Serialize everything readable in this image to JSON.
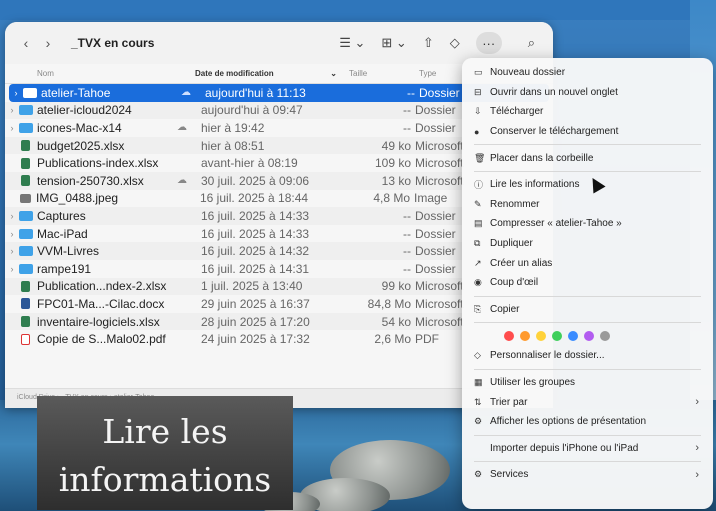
{
  "finder": {
    "title": "_TVX en cours",
    "columns": {
      "name": "Nom",
      "date": "Date de modification",
      "size": "Taille",
      "type": "Type"
    },
    "rows": [
      {
        "name": "atelier-Tahoe",
        "date": "aujourd'hui à 11:13",
        "size": "--",
        "type": "Dossier",
        "icon": "folder-icon",
        "selected": true,
        "cloud": "cloud-icon",
        "expand": "›"
      },
      {
        "name": "atelier-icloud2024",
        "date": "aujourd'hui à 09:47",
        "size": "--",
        "type": "Dossier",
        "icon": "folder-icon",
        "cloud": "",
        "expand": "›"
      },
      {
        "name": "icones-Mac-x14",
        "date": "hier à 19:42",
        "size": "--",
        "type": "Dossier",
        "icon": "folder-icon",
        "cloud": "cloud-icon",
        "expand": "›"
      },
      {
        "name": "budget2025.xlsx",
        "date": "hier à 08:51",
        "size": "49 ko",
        "type": "Microsoft",
        "icon": "excel-icon",
        "cloud": "",
        "expand": ""
      },
      {
        "name": "Publications-index.xlsx",
        "date": "avant-hier à 08:19",
        "size": "109 ko",
        "type": "Microsoft",
        "icon": "excel-icon",
        "cloud": "",
        "expand": ""
      },
      {
        "name": "tension-250730.xlsx",
        "date": "30 juil. 2025 à 09:06",
        "size": "13 ko",
        "type": "Microsoft",
        "icon": "excel-icon",
        "cloud": "cloud-icon",
        "expand": ""
      },
      {
        "name": "IMG_0488.jpeg",
        "date": "16 juil. 2025 à 18:44",
        "size": "4,8 Mo",
        "type": "Image",
        "icon": "image-icon",
        "cloud": "",
        "expand": ""
      },
      {
        "name": "Captures",
        "date": "16 juil. 2025 à 14:33",
        "size": "--",
        "type": "Dossier",
        "icon": "folder-icon",
        "cloud": "",
        "expand": "›"
      },
      {
        "name": "Mac-iPad",
        "date": "16 juil. 2025 à 14:33",
        "size": "--",
        "type": "Dossier",
        "icon": "folder-icon",
        "cloud": "",
        "expand": "›"
      },
      {
        "name": "VVM-Livres",
        "date": "16 juil. 2025 à 14:32",
        "size": "--",
        "type": "Dossier",
        "icon": "folder-icon",
        "cloud": "",
        "expand": "›"
      },
      {
        "name": "rampe191",
        "date": "16 juil. 2025 à 14:31",
        "size": "--",
        "type": "Dossier",
        "icon": "folder-icon",
        "cloud": "",
        "expand": "›"
      },
      {
        "name": "Publication...ndex-2.xlsx",
        "date": "1 juil. 2025 à 13:40",
        "size": "99 ko",
        "type": "Microsoft",
        "icon": "excel-icon",
        "cloud": "",
        "expand": ""
      },
      {
        "name": "FPC01-Ma...-Cilac.docx",
        "date": "29 juin 2025 à 16:37",
        "size": "84,8 Mo",
        "type": "Microsoft",
        "icon": "word-icon",
        "cloud": "",
        "expand": ""
      },
      {
        "name": "inventaire-logiciels.xlsx",
        "date": "28 juin 2025 à 17:20",
        "size": "54 ko",
        "type": "Microsoft",
        "icon": "excel-icon",
        "cloud": "",
        "expand": ""
      },
      {
        "name": "Copie de S...Malo02.pdf",
        "date": "24 juin 2025 à 17:32",
        "size": "2,6 Mo",
        "type": "PDF",
        "icon": "pdf-icon",
        "cloud": "",
        "expand": ""
      }
    ],
    "pathbar": "iCloud Drive › _TVX en cours › atelier-Tahoe"
  },
  "caption": {
    "line1": "Lire les",
    "line2": "informations"
  },
  "menu": {
    "items": [
      {
        "label": "Nouveau dossier",
        "icon": "new-folder-icon",
        "glyph": "▭"
      },
      {
        "label": "Ouvrir dans un nouvel onglet",
        "icon": "tab-icon",
        "glyph": "⊟"
      },
      {
        "label": "Télécharger",
        "icon": "download-icon",
        "glyph": "⇩"
      },
      {
        "label": "Conserver le téléchargement",
        "icon": "keep-icon",
        "glyph": "●"
      },
      {
        "sep": true
      },
      {
        "label": "Placer dans la corbeille",
        "icon": "trash-icon",
        "glyph": "🗑"
      },
      {
        "sep": true
      },
      {
        "label": "Lire les informations",
        "icon": "info-icon",
        "glyph": "ⓘ"
      },
      {
        "label": "Renommer",
        "icon": "pencil-icon",
        "glyph": "✎"
      },
      {
        "label": "Compresser « atelier-Tahoe »",
        "icon": "archive-icon",
        "glyph": "▤"
      },
      {
        "label": "Dupliquer",
        "icon": "duplicate-icon",
        "glyph": "⧉"
      },
      {
        "label": "Créer un alias",
        "icon": "alias-icon",
        "glyph": "↗"
      },
      {
        "label": "Coup d'œil",
        "icon": "eye-icon",
        "glyph": "◉"
      },
      {
        "sep": true
      },
      {
        "label": "Copier",
        "icon": "copy-icon",
        "glyph": "⎘"
      },
      {
        "sep": true
      },
      {
        "colors": true
      },
      {
        "label": "Personnaliser le dossier...",
        "icon": "tag-icon",
        "glyph": "◇"
      },
      {
        "sep": true
      },
      {
        "label": "Utiliser les groupes",
        "icon": "groups-icon",
        "glyph": "▦"
      },
      {
        "label": "Trier par",
        "icon": "sort-icon",
        "glyph": "⇅",
        "submenu": true
      },
      {
        "label": "Afficher les options de présentation",
        "icon": "options-icon",
        "glyph": "⚙"
      },
      {
        "sep": true
      },
      {
        "label": "Importer depuis l'iPhone ou l'iPad",
        "icon": "",
        "glyph": "",
        "submenu": true
      },
      {
        "sep": true
      },
      {
        "label": "Services",
        "icon": "services-icon",
        "glyph": "⚙",
        "submenu": true
      }
    ],
    "tag_colors": [
      "#ff4d4d",
      "#ff9a2e",
      "#ffd23a",
      "#3fcf5b",
      "#3a8cff",
      "#b25cf0",
      "#9a9a9a"
    ]
  }
}
